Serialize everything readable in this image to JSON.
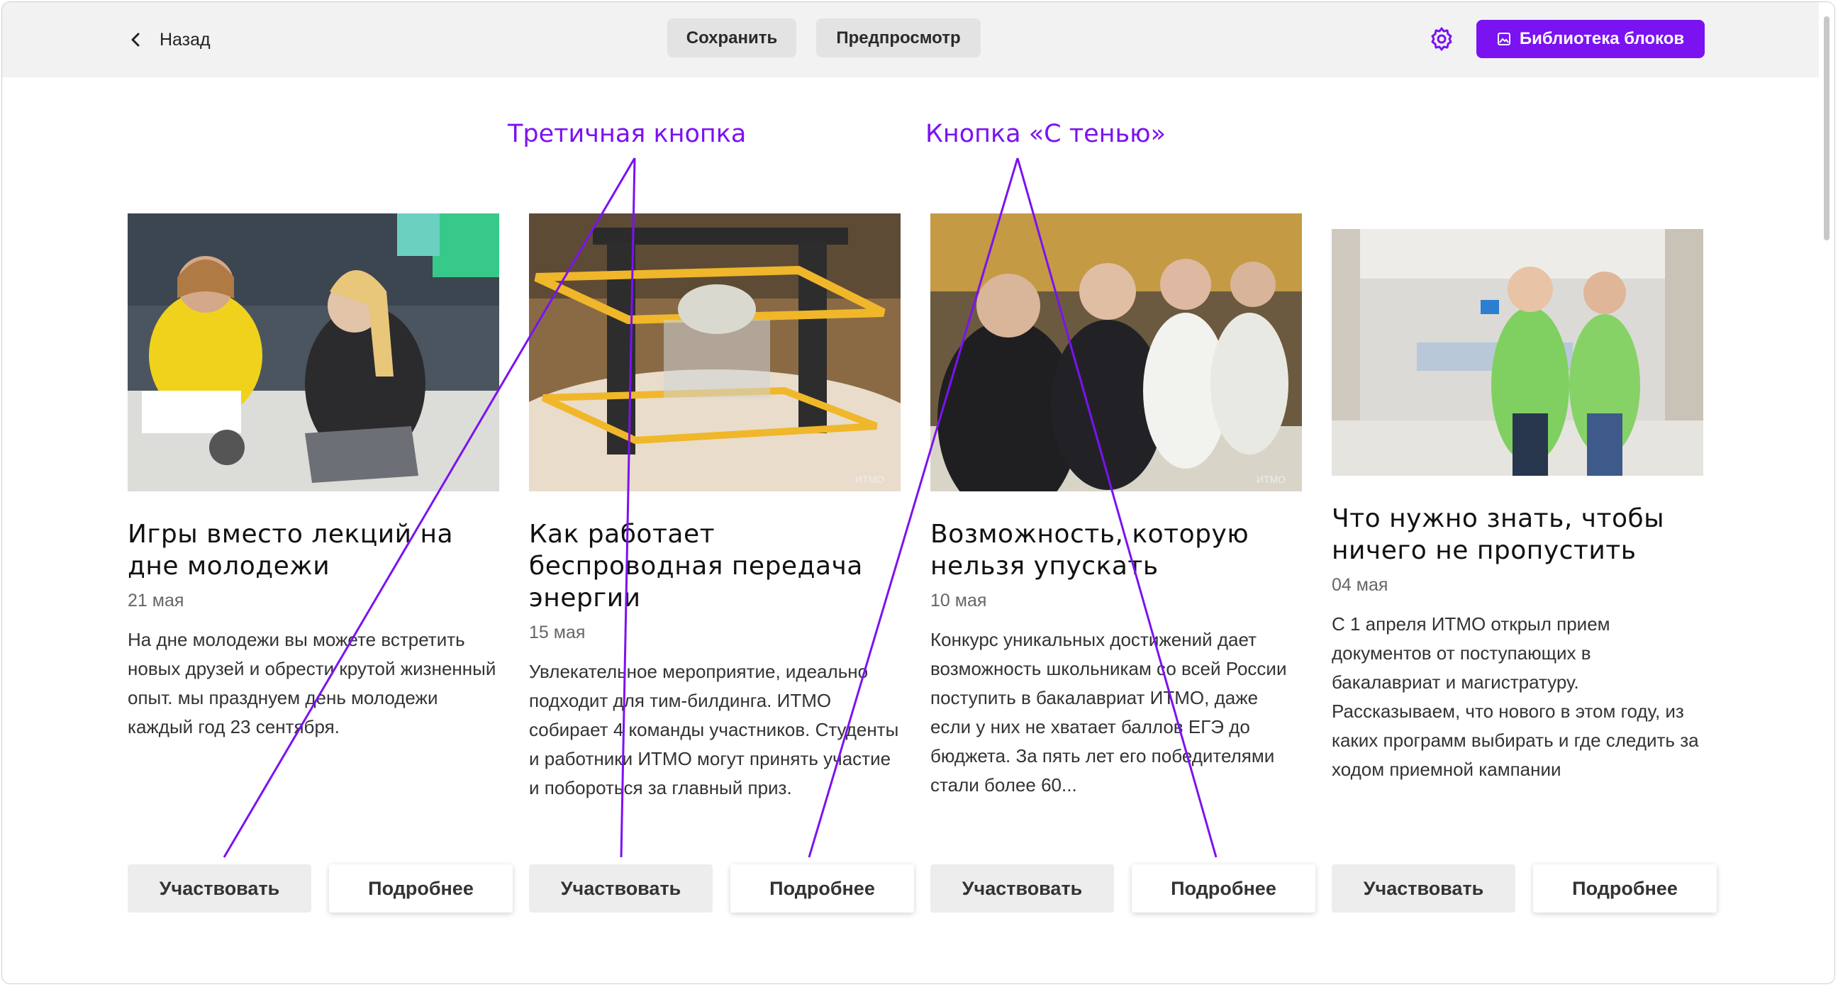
{
  "topbar": {
    "back_label": "Назад",
    "save_label": "Сохранить",
    "preview_label": "Предпросмотр",
    "library_label": "Библиотека блоков"
  },
  "annotations": {
    "tertiary": "Третичная кнопка",
    "shadow": "Кнопка «С тенью»"
  },
  "colors": {
    "accent": "#7b12f2",
    "button_tertiary": "#ededed"
  },
  "cards": [
    {
      "title": "Игры вместо лекций на дне молодежи",
      "date": "21 мая",
      "desc": "На дне молодежи вы можете встретить новых друзей и обрести крутой жизненный опыт. мы празднуем день молодежи каждый год 23 сентября.",
      "btn_primary": "Участвовать",
      "btn_secondary": "Подробнее"
    },
    {
      "title": "Как работает беспроводная передача энергии",
      "date": "15 мая",
      "desc": "Увлекательное мероприятие, идеально подходит для тим-билдинга. ИТМО собирает 4 команды участников. Студенты и работники ИТМО могут принять участие и побороться за главный приз.",
      "btn_primary": "Участвовать",
      "btn_secondary": "Подробнее"
    },
    {
      "title": "Возможность, которую нельзя упускать",
      "date": "10 мая",
      "desc": "Конкурс уникальных достижений дает возможность школьникам со всей России поступить в бакалавриат ИТМО, даже если у них не хватает баллов ЕГЭ до бюджета. За пять лет его победителями стали более 60...",
      "btn_primary": "Участвовать",
      "btn_secondary": "Подробнее"
    },
    {
      "title": "Что нужно знать, чтобы ничего не пропустить",
      "date": "04 мая",
      "desc": "С 1 апреля ИТМО открыл прием документов от поступающих в бакалавриат и магистратуру. Рассказываем, что нового в этом году, из каких программ выбирать и где следить за ходом приемной кампании",
      "btn_primary": "Участвовать",
      "btn_secondary": "Подробнее"
    }
  ]
}
